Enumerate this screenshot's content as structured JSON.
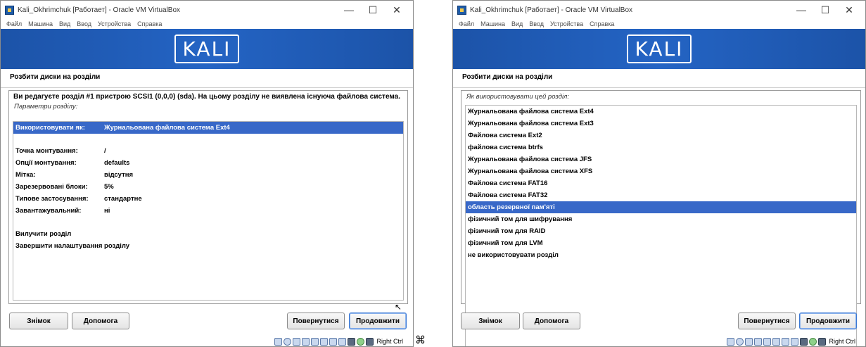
{
  "vm": {
    "title": "Kali_Okhrimchuk [Работает] - Oracle VM VirtualBox",
    "menu": [
      "Файл",
      "Машина",
      "Вид",
      "Ввод",
      "Устройства",
      "Справка"
    ],
    "controls": {
      "minimize": "—",
      "maximize": "☐",
      "close": "✕"
    },
    "brand": "KALI",
    "status_text": "Right Ctrl",
    "status_icons": [
      "hdd-icon",
      "cd-icon",
      "audio-icon",
      "network-icon",
      "usb-icon",
      "shared-folder-icon",
      "display-icon",
      "video-capture-icon",
      "cpu-icon",
      "mouse-integration-icon",
      "keyboard-capture-icon"
    ]
  },
  "left": {
    "section_title": "Розбити диски на розділи",
    "description": "Ви редагуєте розділ #1 пристрою SCSI1 (0,0,0) (sda). На цьому розділу не виявлена існуюча файлова система.",
    "subtitle": "Параметри розділу:",
    "params": [
      {
        "key": "Використовувати як:",
        "value": "Журнальована файлова система Ext4",
        "selected": true
      },
      {
        "key": "Точка монтування:",
        "value": "/"
      },
      {
        "key": "Опції монтування:",
        "value": "defaults"
      },
      {
        "key": "Мітка:",
        "value": "відсутня"
      },
      {
        "key": "Зарезервовані блоки:",
        "value": "5%"
      },
      {
        "key": "Типове застосування:",
        "value": "стандартне"
      },
      {
        "key": "Завантажувальний:",
        "value": "ні"
      }
    ],
    "actions": [
      "Вилучити розділ",
      "Завершити налаштування розділу"
    ]
  },
  "right": {
    "section_title": "Розбити диски на розділи",
    "subtitle": "Як використовувати цей розділ:",
    "options": [
      "Журнальована файлова система Ext4",
      "Журнальована файлова система Ext3",
      "Файлова система Ext2",
      "файлова система btrfs",
      "Журнальована файлова система JFS",
      "Журнальована файлова система XFS",
      "Файлова система FAT16",
      "Файлова система FAT32",
      "область резервної пам'яті",
      "фізичний том для шифрування",
      "фізичний том для RAID",
      "фізичний том для LVM",
      "не використовувати розділ"
    ],
    "selected_index": 8
  },
  "buttons": {
    "screenshot": "Знімок",
    "help": "Допомога",
    "back": "Повернутися",
    "continue": "Продовжити"
  },
  "colors": {
    "banner": "#2464c4",
    "selection": "#3868c8"
  }
}
